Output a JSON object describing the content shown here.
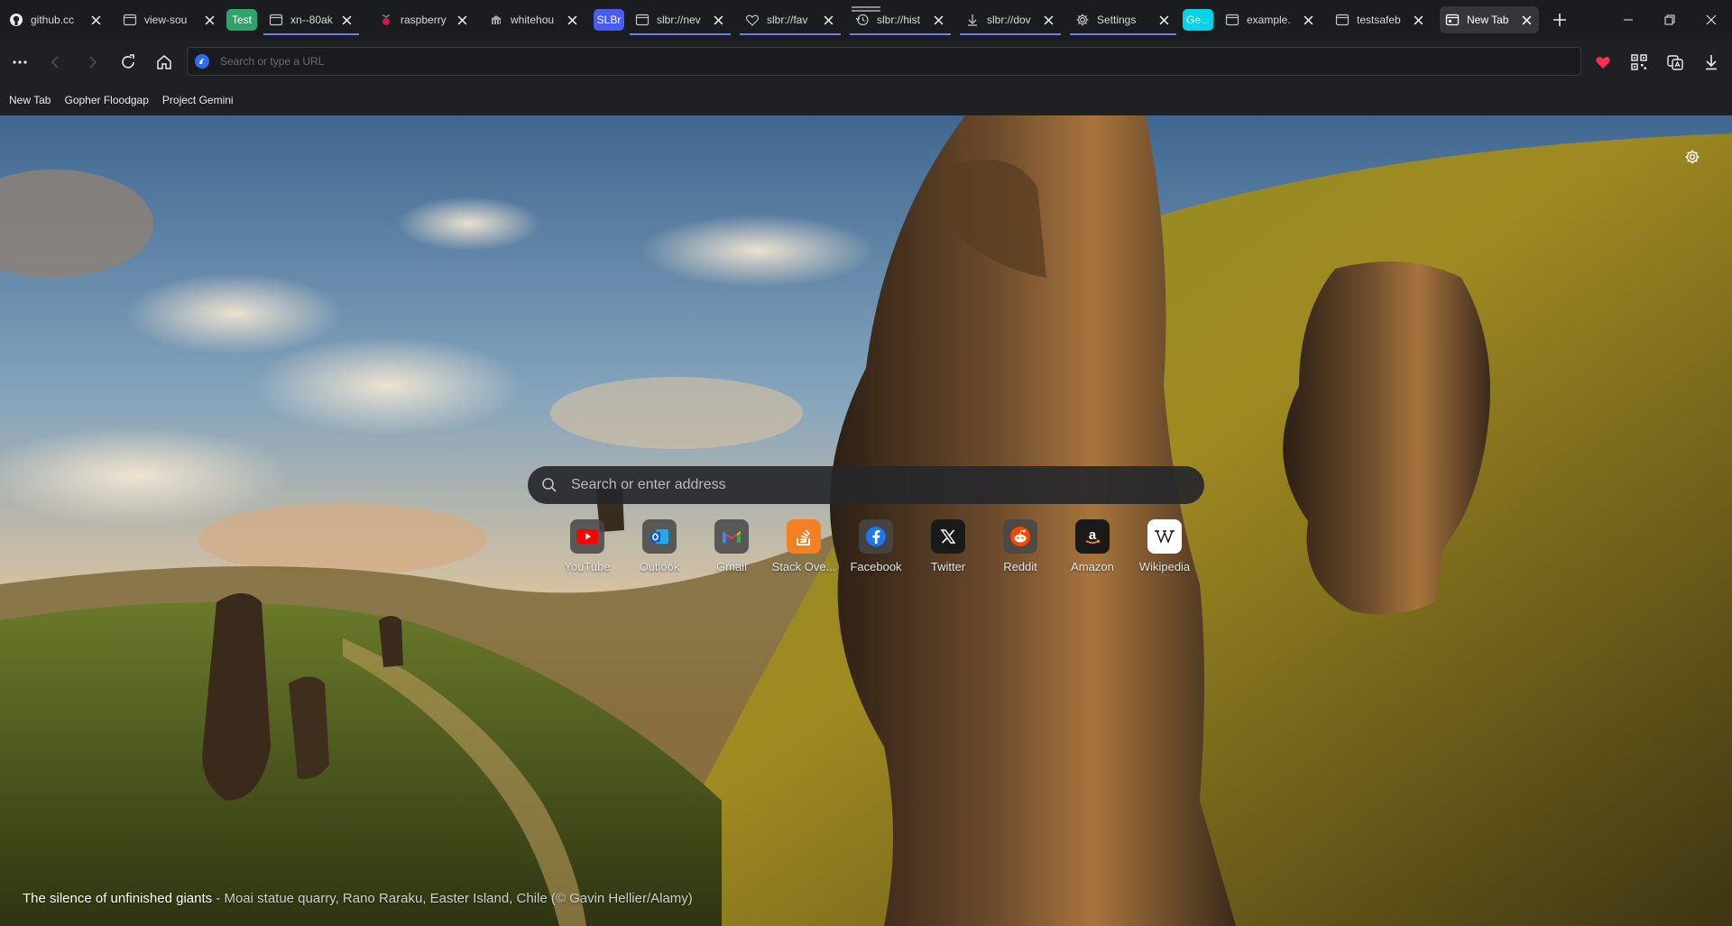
{
  "tabs": [
    {
      "title": "github.cc",
      "icon": "github-icon"
    },
    {
      "title": "view-sou",
      "icon": "page-icon"
    },
    {
      "group": "Test",
      "color": "#2ea36a"
    },
    {
      "title": "xn--80ak",
      "icon": "page-icon"
    },
    {
      "title": "raspberry",
      "icon": "raspberry-icon"
    },
    {
      "title": "whitehou",
      "icon": "whitehouse-icon"
    },
    {
      "group": "SLBr",
      "color": "#4a5cf0"
    },
    {
      "title": "slbr://nev",
      "icon": "page-icon"
    },
    {
      "title": "slbr://fav",
      "icon": "heart-icon"
    },
    {
      "title": "slbr://hist",
      "icon": "history-icon"
    },
    {
      "title": "slbr://dov",
      "icon": "download-icon"
    },
    {
      "title": "Settings",
      "icon": "gear-icon"
    },
    {
      "group": "Ge...",
      "color": "#00d4e8"
    },
    {
      "title": "example.",
      "icon": "page-icon"
    },
    {
      "title": "testsafeb",
      "icon": "page-icon"
    },
    {
      "title": "New Tab",
      "icon": "newtab-icon",
      "active": true
    }
  ],
  "toolbar": {
    "url_placeholder": "Search or type a URL"
  },
  "bookmarks": [
    "New Tab",
    "Gopher Floodgap",
    "Project Gemini"
  ],
  "newtab": {
    "search_placeholder": "Search or enter address",
    "tiles": [
      {
        "label": "YouTube",
        "icon": "youtube-icon"
      },
      {
        "label": "Outlook",
        "icon": "outlook-icon"
      },
      {
        "label": "Gmail",
        "icon": "gmail-icon"
      },
      {
        "label": "Stack Ove...",
        "icon": "stackoverflow-icon"
      },
      {
        "label": "Facebook",
        "icon": "facebook-icon"
      },
      {
        "label": "Twitter",
        "icon": "twitter-x-icon"
      },
      {
        "label": "Reddit",
        "icon": "reddit-icon"
      },
      {
        "label": "Amazon",
        "icon": "amazon-icon"
      },
      {
        "label": "Wikipedia",
        "icon": "wikipedia-icon"
      }
    ],
    "caption_title": "The silence of unfinished giants",
    "caption_sub": " - Moai statue quarry, Rano Raraku, Easter Island, Chile (© Gavin Hellier/Alamy)"
  },
  "colors": {
    "accent": "#6b7cff",
    "heart": "#ff2d55"
  }
}
